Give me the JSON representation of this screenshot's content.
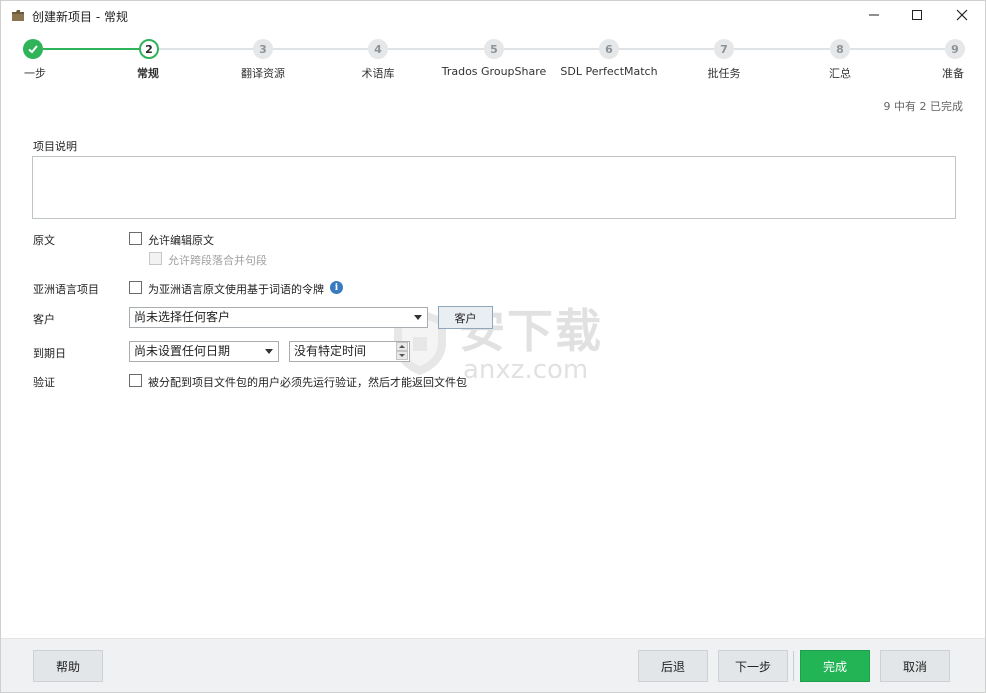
{
  "window": {
    "title": "创建新项目 - 常规",
    "icons": {
      "app": "folder-icon",
      "minimize": "minimize-icon",
      "maximize": "maximize-icon",
      "close": "close-icon"
    }
  },
  "steps": [
    {
      "number": "1",
      "label": "一步",
      "state": "done"
    },
    {
      "number": "2",
      "label": "常规",
      "state": "current"
    },
    {
      "number": "3",
      "label": "翻译资源",
      "state": "pending"
    },
    {
      "number": "4",
      "label": "术语库",
      "state": "pending"
    },
    {
      "number": "5",
      "label": "Trados GroupShare",
      "state": "pending"
    },
    {
      "number": "6",
      "label": "SDL PerfectMatch",
      "state": "pending"
    },
    {
      "number": "7",
      "label": "批任务",
      "state": "pending"
    },
    {
      "number": "8",
      "label": "汇总",
      "state": "pending"
    },
    {
      "number": "9",
      "label": "准备",
      "state": "pending"
    }
  ],
  "progress_text": "9 中有 2 已完成",
  "form": {
    "description_label": "项目说明",
    "description_value": "",
    "source_label": "原文",
    "allow_edit_source": {
      "label": "允许编辑原文",
      "checked": false
    },
    "allow_merge_across": {
      "label": "允许跨段落合并句段",
      "checked": false,
      "disabled": true
    },
    "asian_label": "亚洲语言项目",
    "asian_token": {
      "label": "为亚洲语言原文使用基于词语的令牌",
      "checked": false
    },
    "customer_label": "客户",
    "customer_value": "尚未选择任何客户",
    "customer_button": "客户",
    "due_label": "到期日",
    "due_date_value": "尚未设置任何日期",
    "due_time_value": "没有特定时间",
    "verify_label": "验证",
    "verify": {
      "label": "被分配到项目文件包的用户必须先运行验证，然后才能返回文件包",
      "checked": false
    }
  },
  "footer": {
    "help": "帮助",
    "back": "后退",
    "next": "下一步",
    "finish": "完成",
    "cancel": "取消"
  },
  "watermark": {
    "cn": "安下载",
    "en": "anxz.com"
  },
  "colors": {
    "accent": "#2fb45a",
    "finish_button": "#22b455",
    "info": "#3a7bbf"
  }
}
